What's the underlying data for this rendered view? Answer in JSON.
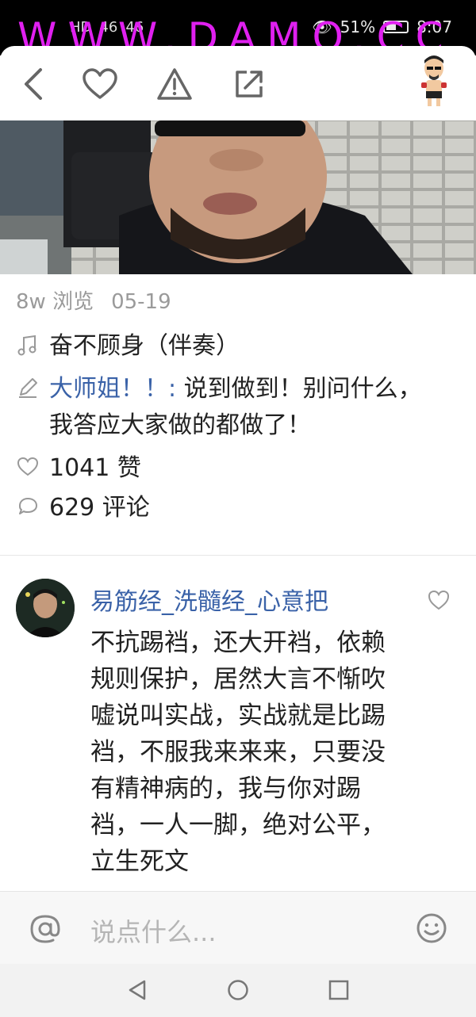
{
  "status_bar": {
    "left_indicators": [
      "HD",
      "46",
      "46"
    ],
    "battery": "51%",
    "time": "8:07",
    "watermark": "WWW.DAMO.CC"
  },
  "nav": {
    "back_icon": "back-arrow-icon",
    "like_icon": "heart-icon",
    "report_icon": "warning-icon",
    "share_icon": "share-icon"
  },
  "post": {
    "views": "8w 浏览",
    "date": "05-19",
    "song": "奋不顾身（伴奏）",
    "author": "大师姐！！:",
    "caption": " 说到做到！别问什么，我答应大家做的都做了！",
    "likes": "1041 赞",
    "comments": "629 评论"
  },
  "comment": {
    "username": "易筋经_洗髓经_心意把",
    "text": "  不抗踢裆，还大开裆，依赖规则保护，居然大言不惭吹嘘说叫实战，实战就是比踢裆，不服我来来来，只要没有精神病的，我与你对踢裆，一人一脚，绝对公平，立生死文"
  },
  "input": {
    "placeholder": "说点什么..."
  },
  "colors": {
    "link": "#3a62a8",
    "watermark": "#e020f0"
  }
}
